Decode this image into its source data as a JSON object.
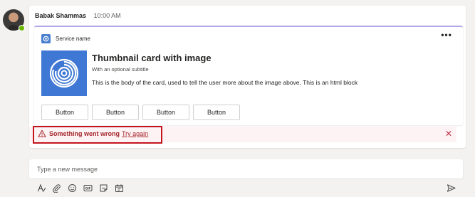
{
  "message": {
    "sender": "Babak Shammas",
    "time": "10:00 AM"
  },
  "card": {
    "service_name": "Service name",
    "title": "Thumbnail card with image",
    "subtitle": "With an optional subtitle",
    "body": "This is the body of the card, used to tell the user more about the image above. This is an html block",
    "buttons": [
      "Button",
      "Button",
      "Button",
      "Button"
    ]
  },
  "error": {
    "text": "Something went wrong",
    "retry_label": "Try again"
  },
  "compose": {
    "placeholder": "Type a new message"
  },
  "icons": {
    "toolbar": [
      "format-icon",
      "attach-icon",
      "emoji-icon",
      "gif-icon",
      "sticker-icon",
      "schedule-icon",
      "send-icon"
    ]
  },
  "colors": {
    "accent": "#b4a9e8",
    "error": "#a4262c",
    "error_bg": "#fdf3f4",
    "highlight": "#c4151c",
    "thumbnail": "#3f78d4",
    "presence": "#6bb700"
  }
}
